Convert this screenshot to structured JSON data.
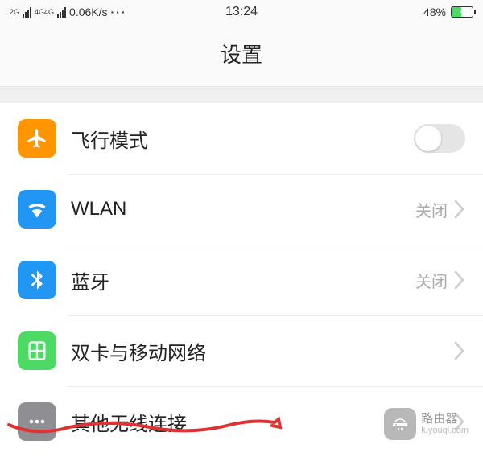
{
  "status": {
    "signal1_label": "2G",
    "signal2_label": "4G4G",
    "speed": "0.06K/s",
    "time": "13:24",
    "battery_pct": "48%",
    "battery_fill_width": "48%"
  },
  "header": {
    "title": "设置"
  },
  "rows": {
    "airplane": {
      "label": "飞行模式",
      "icon": "airplane-icon",
      "toggle_on": false
    },
    "wlan": {
      "label": "WLAN",
      "value": "关闭",
      "icon": "wifi-icon"
    },
    "bluetooth": {
      "label": "蓝牙",
      "value": "关闭",
      "icon": "bluetooth-icon"
    },
    "sim": {
      "label": "双卡与移动网络",
      "icon": "sim-icon"
    },
    "other": {
      "label": "其他无线连接",
      "icon": "more-icon"
    }
  },
  "watermark": {
    "title": "路由器",
    "url": "luyouqi.com"
  }
}
